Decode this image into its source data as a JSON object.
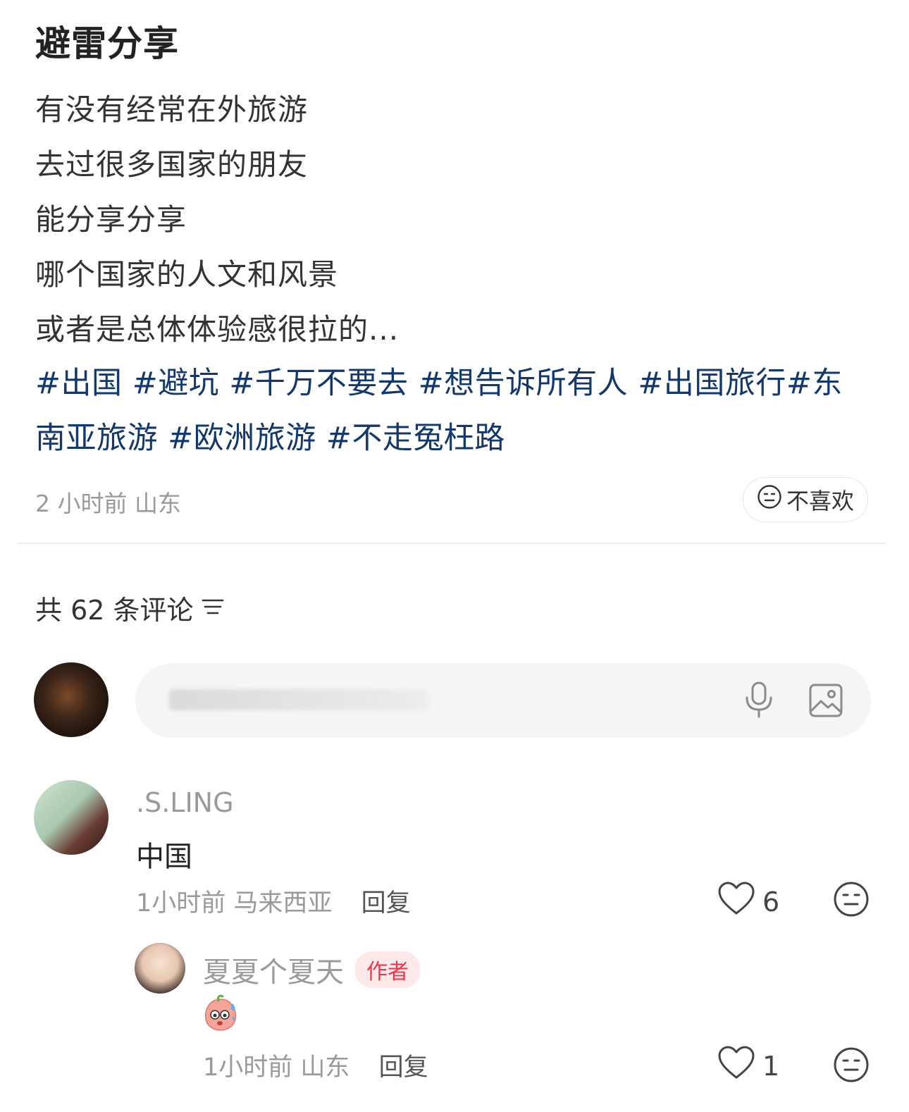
{
  "post": {
    "title": "避雷分享",
    "lines": [
      "有没有经常在外旅游",
      "去过很多国家的朋友",
      "能分享分享",
      "哪个国家的人文和风景",
      "或者是总体体验感很拉的..."
    ],
    "tags_line1": [
      "#出国",
      "#避坑",
      "#千万不要去",
      "#想告诉所有人",
      "#出国旅行",
      "#东"
    ],
    "tags_line2": [
      "南亚旅游",
      "#欧洲旅游",
      "#不走冤枉路"
    ],
    "time": "2 小时前",
    "location": "山东",
    "dislike_label": "不喜欢"
  },
  "comments_header": {
    "label": "共 62 条评论"
  },
  "comment_input": {
    "placeholder": ""
  },
  "comments": [
    {
      "user": ".S.LING",
      "text": "中国",
      "time": "1小时前",
      "location": "马来西亚",
      "reply_label": "回复",
      "likes": "6"
    }
  ],
  "replies": [
    {
      "user": "夏夏个夏天",
      "badge": "作者",
      "time": "1小时前",
      "location": "山东",
      "reply_label": "回复",
      "likes": "1"
    }
  ],
  "icons": {
    "dislike": "neutral-face-icon",
    "sort": "sort-lines-icon",
    "mic": "microphone-icon",
    "image": "image-icon",
    "like": "heart-icon",
    "emoji_reply": "sweating-peach-emoji"
  },
  "colors": {
    "tag": "#13386c",
    "author_badge_text": "#e8384f",
    "author_badge_bg": "#fde8ea"
  }
}
